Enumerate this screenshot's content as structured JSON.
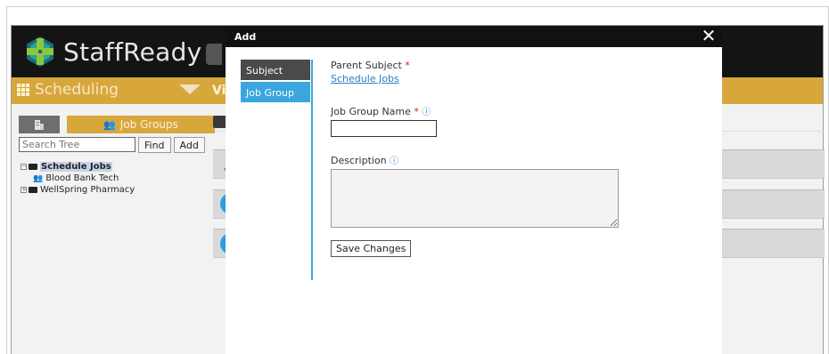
{
  "app": {
    "logo_text": "StaffReady",
    "module": "Scheduling",
    "view_stub": "Vi",
    "colors": {
      "topbar": "#141414",
      "accent_gold": "#d8a73b",
      "link_blue": "#2b7dc7",
      "nav_active": "#3aa6dd"
    }
  },
  "tree_panel": {
    "tab_label": "Job Groups",
    "search_placeholder": "Search Tree",
    "find_label": "Find",
    "add_label": "Add",
    "nodes": [
      {
        "label": "Schedule Jobs",
        "icon": "folder-icon",
        "selected": true
      },
      {
        "label": "Blood Bank Tech",
        "icon": "people-icon"
      },
      {
        "label": "WellSpring Pharmacy",
        "icon": "folder-icon"
      }
    ]
  },
  "dialog": {
    "title": "Add",
    "close_symbol": "✕",
    "nav": [
      "Subject",
      "Job Group"
    ],
    "parent_subject_label": "Parent Subject",
    "parent_subject_value": "Schedule Jobs",
    "required_mark": "*",
    "info_symbol": "ⓘ",
    "job_group_name_label": "Job Group Name",
    "job_group_name_value": "",
    "description_label": "Description",
    "description_value": "",
    "save_label": "Save Changes"
  }
}
